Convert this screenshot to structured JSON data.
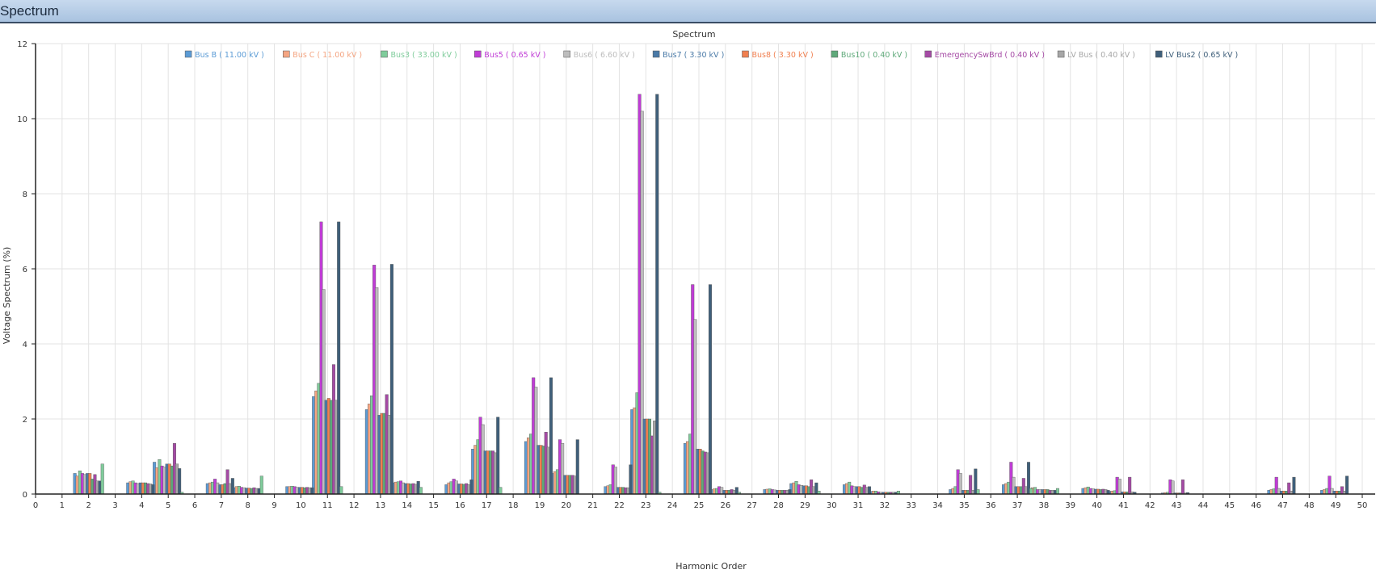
{
  "window": {
    "title": "Spectrum"
  },
  "chart_data": {
    "type": "bar",
    "title": "Spectrum",
    "xlabel": "Harmonic Order",
    "ylabel": "Voltage Spectrum (%)",
    "ylim": [
      0,
      12
    ],
    "yticks": [
      0,
      2,
      4,
      6,
      8,
      10,
      12
    ],
    "xlim": [
      0,
      50
    ],
    "xticks": [
      0,
      1,
      2,
      3,
      4,
      5,
      6,
      7,
      8,
      9,
      10,
      11,
      12,
      13,
      14,
      15,
      16,
      17,
      18,
      19,
      20,
      21,
      22,
      23,
      24,
      25,
      26,
      27,
      28,
      29,
      30,
      31,
      32,
      33,
      34,
      35,
      36,
      37,
      38,
      39,
      40,
      41,
      42,
      43,
      44,
      45,
      46,
      47,
      48,
      49,
      50
    ],
    "grid": true,
    "legend_position": "top-center",
    "categories": [
      2,
      4,
      5,
      7,
      8,
      10,
      11,
      13,
      14,
      16,
      17,
      19,
      20,
      22,
      23,
      25,
      26,
      28,
      29,
      31,
      32,
      35,
      37,
      38,
      40,
      41,
      43,
      47,
      49
    ],
    "series": [
      {
        "name": "Bus B ( 11.00 kV )",
        "color": "#5b9bd5",
        "values": [
          0.55,
          0.3,
          0.85,
          0.28,
          0.17,
          0.2,
          2.6,
          2.25,
          0.3,
          0.25,
          1.2,
          1.4,
          0.55,
          0.2,
          2.25,
          1.35,
          0.12,
          0.12,
          0.28,
          0.25,
          0.07,
          0.12,
          0.25,
          0.15,
          0.15,
          0.07,
          0.03,
          0.1,
          0.1
        ]
      },
      {
        "name": "Bus C ( 11.00 kV )",
        "color": "#f4a582",
        "values": [
          0.48,
          0.33,
          0.7,
          0.3,
          0.2,
          0.2,
          2.75,
          2.4,
          0.32,
          0.3,
          1.3,
          1.5,
          0.6,
          0.22,
          2.3,
          1.4,
          0.14,
          0.13,
          0.3,
          0.28,
          0.08,
          0.15,
          0.28,
          0.17,
          0.17,
          0.08,
          0.04,
          0.12,
          0.12
        ]
      },
      {
        "name": "Bus3 ( 33.00 kV )",
        "color": "#7fcc9b",
        "values": [
          0.62,
          0.35,
          0.92,
          0.32,
          0.21,
          0.21,
          2.95,
          2.62,
          0.33,
          0.33,
          1.45,
          1.6,
          0.65,
          0.25,
          2.7,
          1.6,
          0.15,
          0.14,
          0.34,
          0.32,
          0.08,
          0.2,
          0.32,
          0.18,
          0.19,
          0.09,
          0.05,
          0.14,
          0.15
        ]
      },
      {
        "name": "Bus5 ( 0.65 kV )",
        "color": "#c03cd6",
        "values": [
          0.55,
          0.3,
          0.75,
          0.4,
          0.18,
          0.2,
          7.25,
          6.1,
          0.35,
          0.4,
          2.05,
          3.1,
          1.45,
          0.78,
          10.65,
          5.58,
          0.2,
          0.12,
          0.25,
          0.22,
          0.06,
          0.65,
          0.85,
          0.12,
          0.15,
          0.45,
          0.38,
          0.45,
          0.48
        ]
      },
      {
        "name": "Bus6 ( 6.60 kV )",
        "color": "#bdbdbd",
        "values": [
          0.52,
          0.28,
          0.72,
          0.3,
          0.17,
          0.18,
          5.45,
          5.5,
          0.3,
          0.35,
          1.85,
          2.85,
          1.35,
          0.72,
          10.2,
          4.65,
          0.18,
          0.11,
          0.23,
          0.2,
          0.05,
          0.55,
          0.45,
          0.12,
          0.14,
          0.4,
          0.35,
          0.15,
          0.15
        ]
      },
      {
        "name": "Bus7 ( 3.30 kV )",
        "color": "#4a7aa7",
        "values": [
          0.55,
          0.3,
          0.8,
          0.25,
          0.16,
          0.18,
          2.5,
          2.1,
          0.28,
          0.27,
          1.15,
          1.3,
          0.5,
          0.18,
          2.0,
          1.2,
          0.1,
          0.1,
          0.22,
          0.2,
          0.05,
          0.1,
          0.2,
          0.12,
          0.13,
          0.06,
          0.03,
          0.08,
          0.08
        ]
      },
      {
        "name": "Bus8 ( 3.30 kV )",
        "color": "#f07f4f",
        "values": [
          0.55,
          0.3,
          0.8,
          0.25,
          0.16,
          0.18,
          2.55,
          2.15,
          0.28,
          0.27,
          1.15,
          1.3,
          0.5,
          0.18,
          2.0,
          1.2,
          0.1,
          0.1,
          0.22,
          0.2,
          0.05,
          0.1,
          0.2,
          0.12,
          0.13,
          0.06,
          0.03,
          0.08,
          0.08
        ]
      },
      {
        "name": "Bus10 ( 0.40 kV )",
        "color": "#5fa97a",
        "values": [
          0.4,
          0.3,
          0.75,
          0.28,
          0.15,
          0.17,
          2.5,
          2.15,
          0.27,
          0.26,
          1.15,
          1.28,
          0.5,
          0.18,
          2.0,
          1.15,
          0.1,
          0.1,
          0.2,
          0.18,
          0.05,
          0.1,
          0.2,
          0.12,
          0.12,
          0.06,
          0.03,
          0.08,
          0.08
        ]
      },
      {
        "name": "EmergencySwBrd ( 0.40 kV )",
        "color": "#a54aa5",
        "values": [
          0.52,
          0.28,
          1.35,
          0.65,
          0.17,
          0.18,
          3.45,
          2.65,
          0.28,
          0.28,
          1.15,
          1.65,
          0.5,
          0.17,
          1.55,
          1.12,
          0.12,
          0.1,
          0.38,
          0.24,
          0.05,
          0.5,
          0.42,
          0.1,
          0.13,
          0.45,
          0.38,
          0.3,
          0.2
        ]
      },
      {
        "name": "LV Bus ( 0.40 kV )",
        "color": "#a7a7a7",
        "values": [
          0.35,
          0.27,
          0.8,
          0.28,
          0.15,
          0.17,
          2.5,
          2.1,
          0.26,
          0.25,
          1.1,
          1.25,
          0.48,
          0.17,
          1.95,
          1.1,
          0.1,
          0.1,
          0.2,
          0.18,
          0.05,
          0.1,
          0.2,
          0.1,
          0.12,
          0.06,
          0.03,
          0.08,
          0.08
        ]
      },
      {
        "name": "LV Bus2 ( 0.65 kV )",
        "color": "#3f5f7a",
        "values": [
          0.35,
          0.25,
          0.68,
          0.42,
          0.15,
          0.17,
          7.25,
          6.12,
          0.34,
          0.38,
          2.05,
          3.1,
          1.45,
          0.78,
          10.65,
          5.58,
          0.18,
          0.12,
          0.3,
          0.2,
          0.05,
          0.67,
          0.85,
          0.1,
          0.1,
          0.05,
          0.04,
          0.45,
          0.48
        ]
      },
      {
        "name": "",
        "color": "#7fcc9b",
        "values": [
          0.8,
          0.0,
          0.05,
          0.0,
          0.48,
          0.0,
          0.2,
          0.0,
          0.18,
          0.0,
          0.18,
          0.0,
          0.0,
          0.0,
          0.05,
          0.0,
          0.05,
          0.0,
          0.08,
          0.0,
          0.08,
          0.12,
          0.15,
          0.15,
          0.0,
          0.0,
          0.0,
          0.0,
          0.0
        ]
      }
    ]
  }
}
